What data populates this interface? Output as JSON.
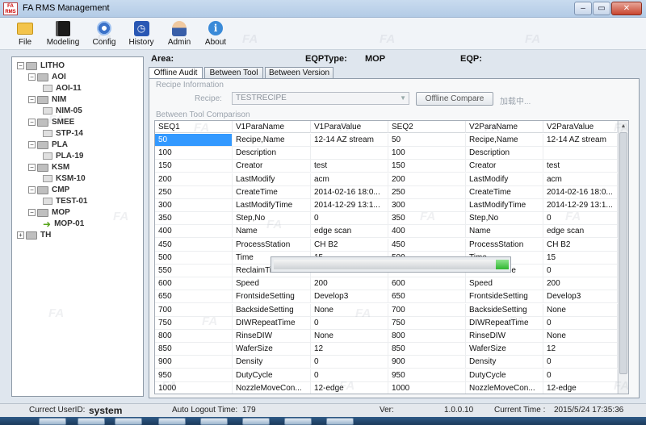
{
  "window": {
    "title": "FA RMS Management",
    "logo_text": "FA RMS",
    "min_glyph": "–",
    "max_glyph": "▭",
    "close_glyph": "✕"
  },
  "toolbar": [
    {
      "name": "tb-file",
      "label": "File",
      "icon": "folder-icon"
    },
    {
      "name": "tb-modeling",
      "label": "Modeling",
      "icon": "book-icon"
    },
    {
      "name": "tb-config",
      "label": "Config",
      "icon": "gear-icon"
    },
    {
      "name": "tb-history",
      "label": "History",
      "icon": "clock-icon"
    },
    {
      "name": "tb-admin",
      "label": "Admin",
      "icon": "admin-icon"
    },
    {
      "name": "tb-about",
      "label": "About",
      "icon": "info-icon"
    }
  ],
  "tree": [
    {
      "label": "LITHO",
      "level": 0,
      "type": "folder"
    },
    {
      "label": "AOI",
      "level": 1,
      "type": "folder"
    },
    {
      "label": "AOI-11",
      "level": 2,
      "type": "leaf"
    },
    {
      "label": "NIM",
      "level": 1,
      "type": "folder"
    },
    {
      "label": "NIM-05",
      "level": 2,
      "type": "leaf"
    },
    {
      "label": "SMEE",
      "level": 1,
      "type": "folder"
    },
    {
      "label": "STP-14",
      "level": 2,
      "type": "leaf"
    },
    {
      "label": "PLA",
      "level": 1,
      "type": "folder"
    },
    {
      "label": "PLA-19",
      "level": 2,
      "type": "leaf"
    },
    {
      "label": "KSM",
      "level": 1,
      "type": "folder"
    },
    {
      "label": "KSM-10",
      "level": 2,
      "type": "leaf"
    },
    {
      "label": "CMP",
      "level": 1,
      "type": "folder"
    },
    {
      "label": "TEST-01",
      "level": 2,
      "type": "leaf"
    },
    {
      "label": "MOP",
      "level": 1,
      "type": "folder"
    },
    {
      "label": "MOP-01",
      "level": 2,
      "type": "selected"
    },
    {
      "label": "TH",
      "level": 0,
      "type": "folder"
    }
  ],
  "header": {
    "area_label": "Area:",
    "eqptype_label": "EQPType:",
    "eqptype_value": "MOP",
    "eqp_label": "EQP:"
  },
  "tabs": {
    "offline_audit": "Offline Audit",
    "between_tool": "Between Tool",
    "between_version": "Between Version"
  },
  "recipe_info": {
    "group_title": "Recipe Information",
    "recipe_label": "Recipe:",
    "recipe_value": "TESTRECIPE",
    "compare_button": "Offline Compare",
    "loading": "加载中..."
  },
  "compare": {
    "group_title": "Between Tool Comparison"
  },
  "grid": {
    "columns": [
      "SEQ1",
      "V1ParaName",
      "V1ParaValue",
      "SEQ2",
      "V2ParaName",
      "V2ParaValue"
    ],
    "rows": [
      [
        "50",
        "Recipe,Name",
        "12-14 AZ stream",
        "50",
        "Recipe,Name",
        "12-14 AZ stream"
      ],
      [
        "100",
        "Description",
        "",
        "100",
        "Description",
        ""
      ],
      [
        "150",
        "Creator",
        "test",
        "150",
        "Creator",
        "test"
      ],
      [
        "200",
        "LastModify",
        "acm",
        "200",
        "LastModify",
        "acm"
      ],
      [
        "250",
        "CreateTime",
        "2014-02-16 18:0...",
        "250",
        "CreateTime",
        "2014-02-16 18:0..."
      ],
      [
        "300",
        "LastModifyTime",
        "2014-12-29 13:1...",
        "300",
        "LastModifyTime",
        "2014-12-29 13:1..."
      ],
      [
        "350",
        "Step,No",
        "0",
        "350",
        "Step,No",
        "0"
      ],
      [
        "400",
        "Name",
        "edge scan",
        "400",
        "Name",
        "edge scan"
      ],
      [
        "450",
        "ProcessStation",
        "CH B2",
        "450",
        "ProcessStation",
        "CH B2"
      ],
      [
        "500",
        "Time",
        "15",
        "500",
        "Time",
        "15"
      ],
      [
        "550",
        "ReclaimTime",
        "0",
        "550",
        "ReclaimTime",
        "0"
      ],
      [
        "600",
        "Speed",
        "200",
        "600",
        "Speed",
        "200"
      ],
      [
        "650",
        "FrontsideSetting",
        "Develop3",
        "650",
        "FrontsideSetting",
        "Develop3"
      ],
      [
        "700",
        "BacksideSetting",
        "None",
        "700",
        "BacksideSetting",
        "None"
      ],
      [
        "750",
        "DIWRepeatTime",
        "0",
        "750",
        "DIWRepeatTime",
        "0"
      ],
      [
        "800",
        "RinseDIW",
        "None",
        "800",
        "RinseDIW",
        "None"
      ],
      [
        "850",
        "WaferSize",
        "12",
        "850",
        "WaferSize",
        "12"
      ],
      [
        "900",
        "Density",
        "0",
        "900",
        "Density",
        "0"
      ],
      [
        "950",
        "DutyCycle",
        "0",
        "950",
        "DutyCycle",
        "0"
      ],
      [
        "1000",
        "NozzleMoveCon...",
        "12-edge",
        "1000",
        "NozzleMoveCon...",
        "12-edge"
      ]
    ]
  },
  "status": {
    "user_label": "Currect UserID:",
    "user_value": "system",
    "logout_label": "Auto Logout Time:",
    "logout_value": "179",
    "ver_label": "Ver:",
    "ver_value": "1.0.0.10",
    "time_label": "Current Time :",
    "time_value": "2015/5/24 17:35:36"
  },
  "colors": {
    "selection": "#3399ff",
    "progress": "#2fb62f"
  }
}
